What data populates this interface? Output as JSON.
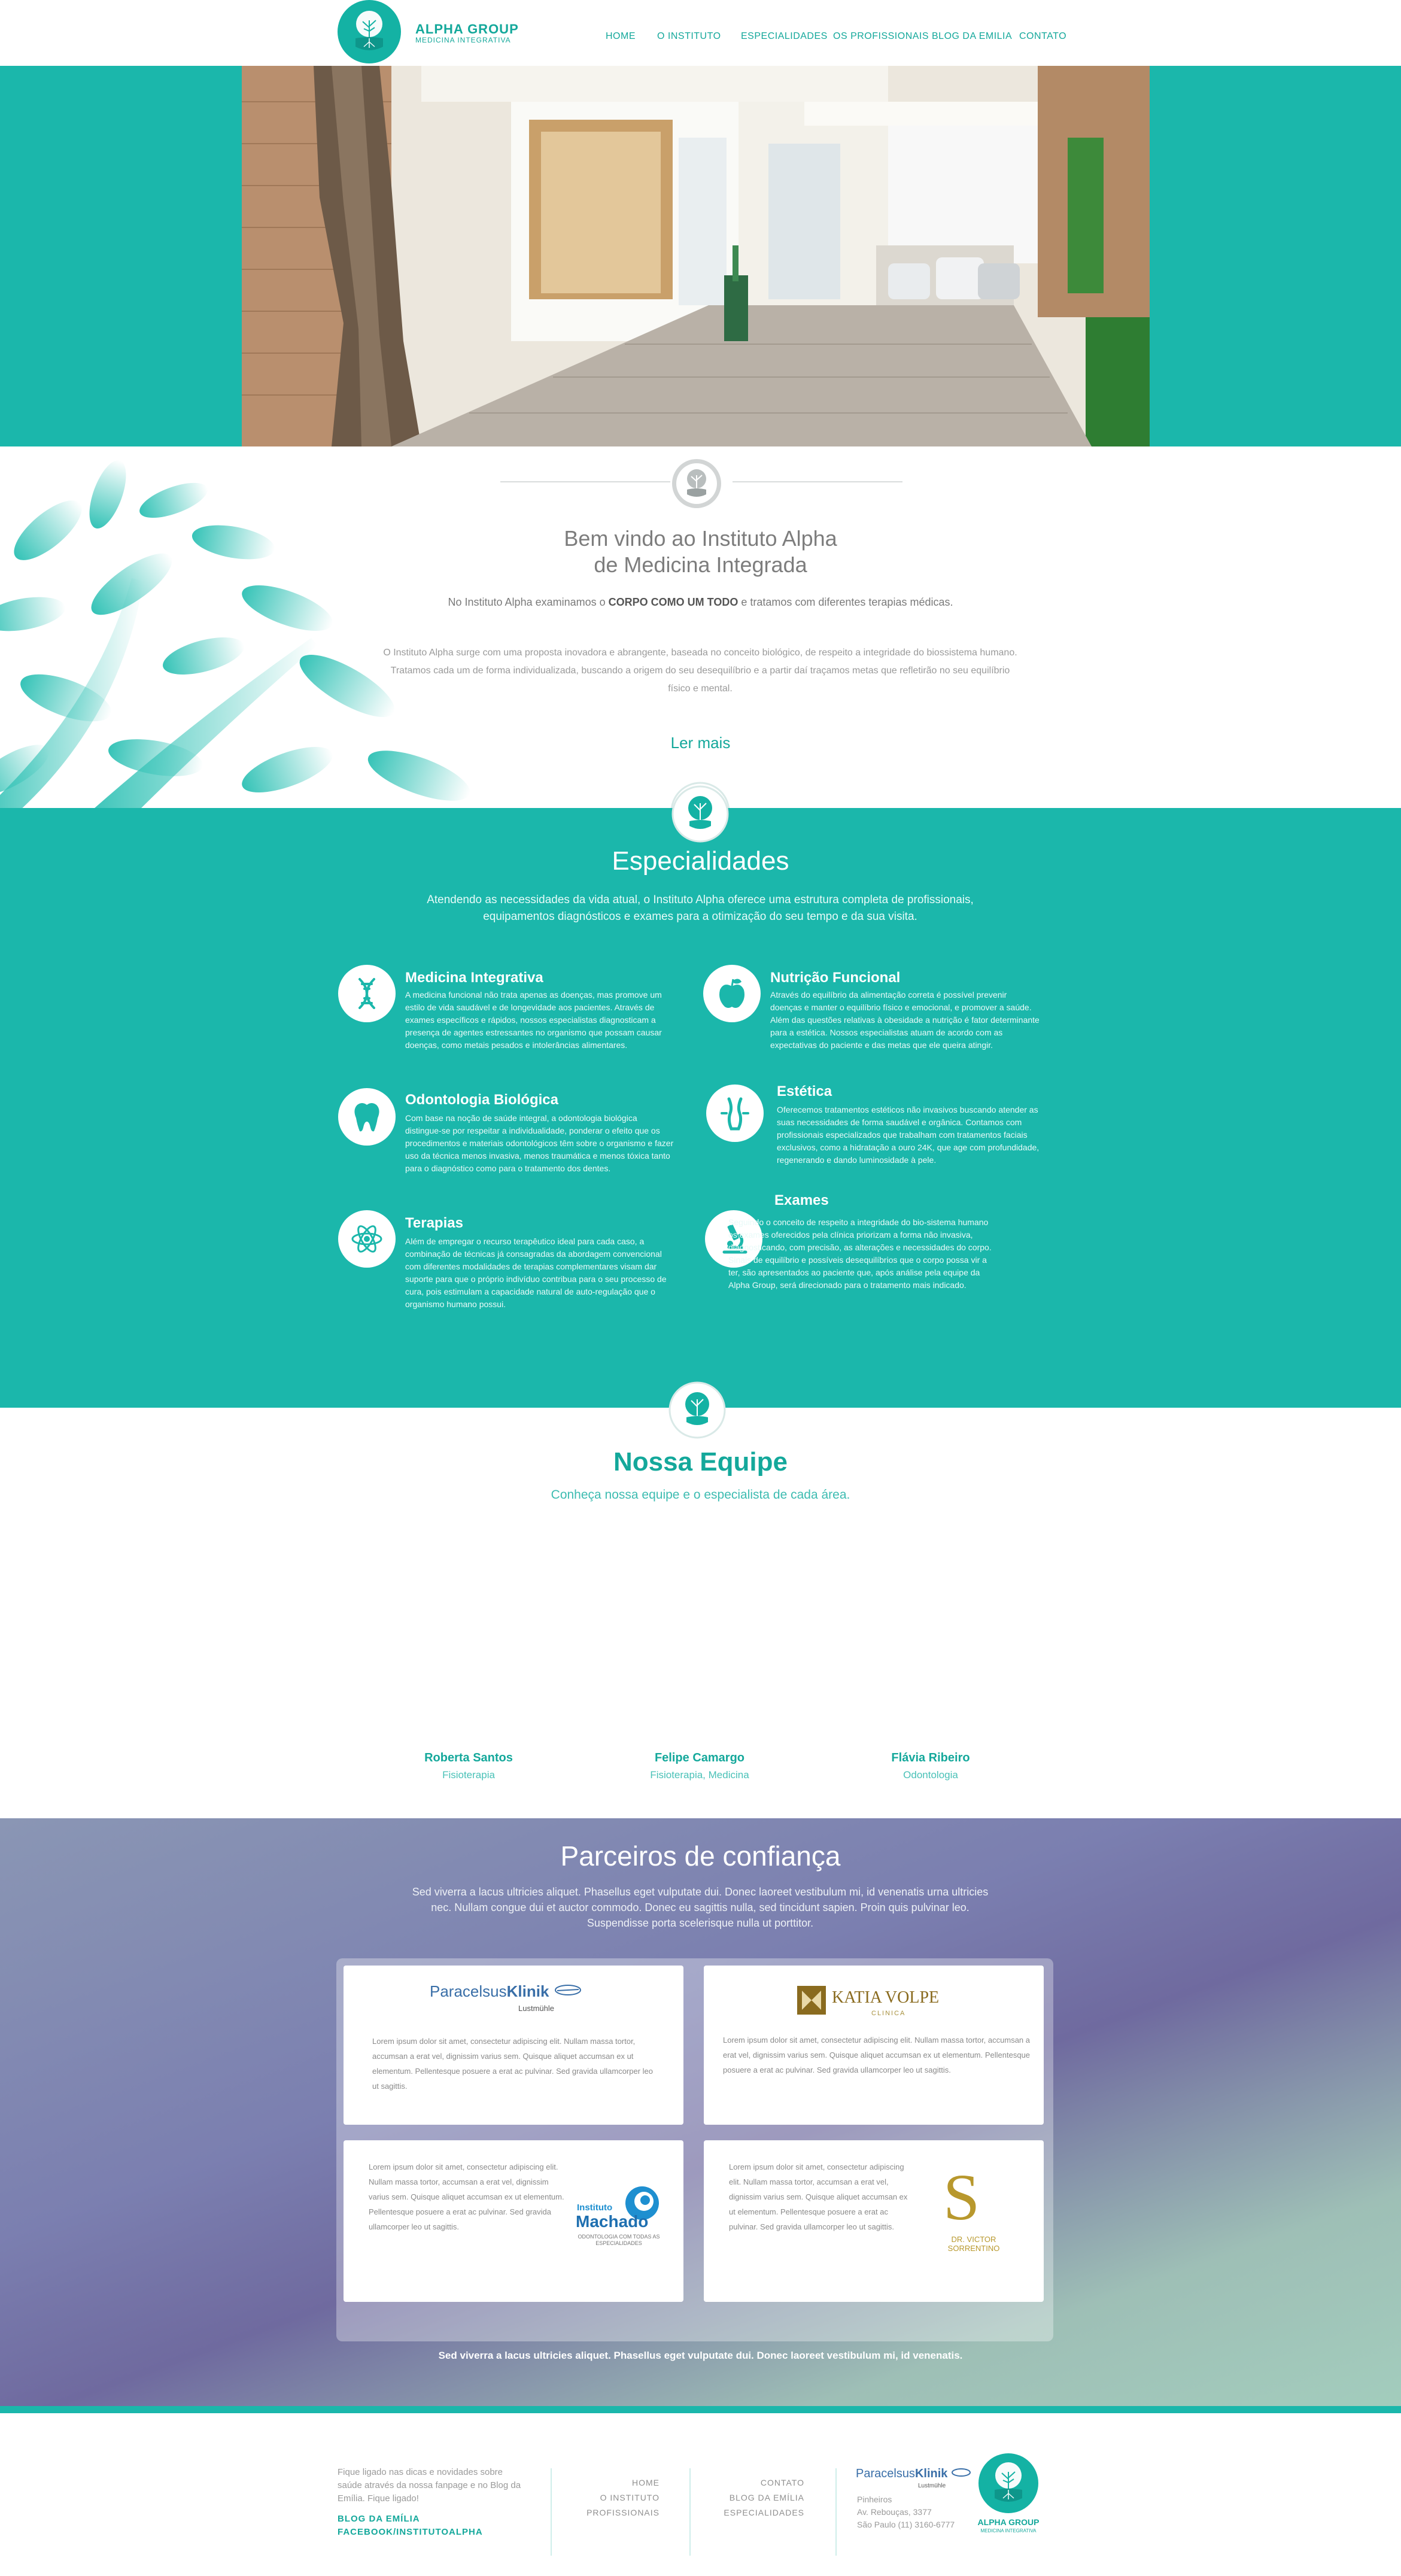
{
  "header": {
    "brand_name": "ALPHA GROUP",
    "brand_sub": "MEDICINA INTEGRATIVA",
    "nav": [
      "HOME",
      "O INSTITUTO",
      "ESPECIALIDADES",
      "OS PROFISSIONAIS",
      "BLOG DA EMILIA",
      "CONTATO"
    ]
  },
  "welcome": {
    "title_line1": "Bem vindo ao Instituto Alpha",
    "title_line2": "de Medicina Integrada",
    "lead_before": "No Instituto Alpha examinamos o ",
    "lead_bold": "CORPO COMO UM TODO",
    "lead_after": " e tratamos com diferentes terapias médicas.",
    "body": "O Instituto Alpha surge com uma proposta inovadora e abrangente, baseada no conceito biológico, de respeito a integridade do biossistema humano. Tratamos cada um de forma individualizada, buscando a origem do seu desequilíbrio e a partir daí traçamos metas que refletirão no seu equilíbrio físico e mental.",
    "read_more": "Ler mais"
  },
  "specialties": {
    "title": "Especialidades",
    "subtitle": "Atendendo as necessidades da vida atual, o Instituto Alpha oferece uma estrutura completa de profissionais, equipamentos diagnósticos e exames para a otimização do seu tempo e da sua visita.",
    "items": [
      {
        "name": "Medicina Integrativa",
        "icon": "dna-icon",
        "desc": "A medicina funcional não trata apenas as doenças, mas promove um estilo de vida saudável e de longevidade aos pacientes. Através de exames específicos e rápidos, nossos especialistas diagnosticam a presença de agentes estressantes no organismo que possam causar doenças, como metais pesados e intolerâncias alimentares."
      },
      {
        "name": "Nutrição Funcional",
        "icon": "apple-icon",
        "desc": "Através do equilíbrio da alimentação correta é possível prevenir doenças e manter o equilíbrio físico e emocional, e promover a saúde. Além das questões relativas à obesidade a nutrição é fator determinante para a estética. Nossos especialistas atuam de acordo com as expectativas do paciente e das metas que ele queira atingir."
      },
      {
        "name": "Odontologia Biológica",
        "icon": "tooth-icon",
        "desc": "Com base na noção de saúde integral, a odontologia biológica distingue-se por respeitar a individualidade, ponderar o efeito que os procedimentos e materiais odontológicos têm sobre o organismo e fazer uso da técnica menos invasiva, menos traumática e menos tóxica tanto para o diagnóstico como para o tratamento dos dentes."
      },
      {
        "name": "Estética",
        "icon": "body-icon",
        "desc": "Oferecemos tratamentos estéticos não invasivos buscando atender as suas necessidades de forma saudável e orgânica. Contamos com profissionais especializados que trabalham com tratamentos faciais exclusivos, como a hidratação a ouro 24K, que age com profundidade, regenerando e dando luminosidade à pele."
      },
      {
        "name": "Terapias",
        "icon": "atom-icon",
        "desc": "Além de empregar o recurso terapêutico ideal para cada caso, a combinação de técnicas já consagradas da abordagem convencional com diferentes modalidades de terapias complementares visam dar suporte para que o próprio indivíduo contribua para o seu processo de cura, pois estimulam a capacidade natural de auto-regulação que o organismo humano possui."
      },
      {
        "name": "Exames",
        "icon": "microscope-icon",
        "desc": "Seguindo o conceito de respeito a integridade do bio-sistema humano os exames oferecidos pela clínica priorizam a forma não invasiva, diagnosticando, com precisão, as alterações e necessidades do corpo. Sinais de equilíbrio e possíveis desequilíbrios que o corpo possa vir a ter, são apresentados ao paciente que, após análise pela equipe da Alpha Group, será direcionado para o tratamento mais indicado."
      }
    ]
  },
  "team": {
    "title": "Nossa Equipe",
    "subtitle": "Conheça nossa equipe e o especialista de cada área.",
    "members": [
      {
        "name": "Roberta Santos",
        "role": "Fisioterapia"
      },
      {
        "name": "Felipe Camargo",
        "role": "Fisioterapia, Medicina"
      },
      {
        "name": "Flávia Ribeiro",
        "role": "Odontologia"
      }
    ]
  },
  "partners": {
    "title": "Parceiros de confiança",
    "subtitle": "Sed viverra a lacus ultricies aliquet. Phasellus eget vulputate dui. Donec laoreet vestibulum mi, id venenatis urna ultricies nec. Nullam congue dui et auctor commodo. Donec eu sagittis nulla, sed tincidunt sapien. Proin quis pulvinar leo. Suspendisse porta scelerisque nulla ut porttitor.",
    "lorem": "Lorem ipsum dolor sit amet, consectetur adipiscing elit. Nullam massa tortor, accumsan a erat vel, dignissim varius sem. Quisque aliquet accumsan ex ut elementum. Pellentesque posuere a erat ac pulvinar. Sed gravida ullamcorper leo ut sagittis.",
    "paracelsus_a": "Paracelsus",
    "paracelsus_b": "Klinik",
    "paracelsus_c": "Lustmühle",
    "katia": "KATIA VOLPE",
    "katia_sub": "CLINICA",
    "machado_a": "Instituto",
    "machado_b": "Machado",
    "machado_c": "ODONTOLOGIA COM TODAS AS ESPECIALIDADES",
    "victor_mono": "S",
    "victor_a": "DR. VICTOR",
    "victor_b": "SORRENTINO",
    "footer_note": "Sed viverra a lacus ultricies aliquet. Phasellus eget vulputate dui. Donec laoreet vestibulum mi, id venenatis."
  },
  "footer": {
    "blog_text": "Fique ligado nas dicas e novidades sobre saúde através da nossa fanpage e no Blog da Emília. Fique ligado!",
    "blog_link": "BLOG DA EMÍLIA",
    "facebook_link": "FACEBOOK/INSTITUTOALPHA",
    "menu_col1": [
      "HOME",
      "O INSTITUTO",
      "PROFISSIONAIS"
    ],
    "menu_col2": [
      "CONTATO",
      "BLOG DA EMÍLIA",
      "ESPECIALIDADES"
    ],
    "partner_a": "Paracelsus",
    "partner_b": "Klinik",
    "partner_c": "Lustmühle",
    "address_1": "Pinheiros",
    "address_2": "Av. Rebouças, 3377",
    "address_3": "São Paulo (11) 3160-6777",
    "brand_name": "ALPHA GROUP",
    "brand_sub": "MEDICINA INTEGRATIVA"
  },
  "colors": {
    "teal": "#1bb7ab",
    "teal_dark": "#14a89b"
  }
}
